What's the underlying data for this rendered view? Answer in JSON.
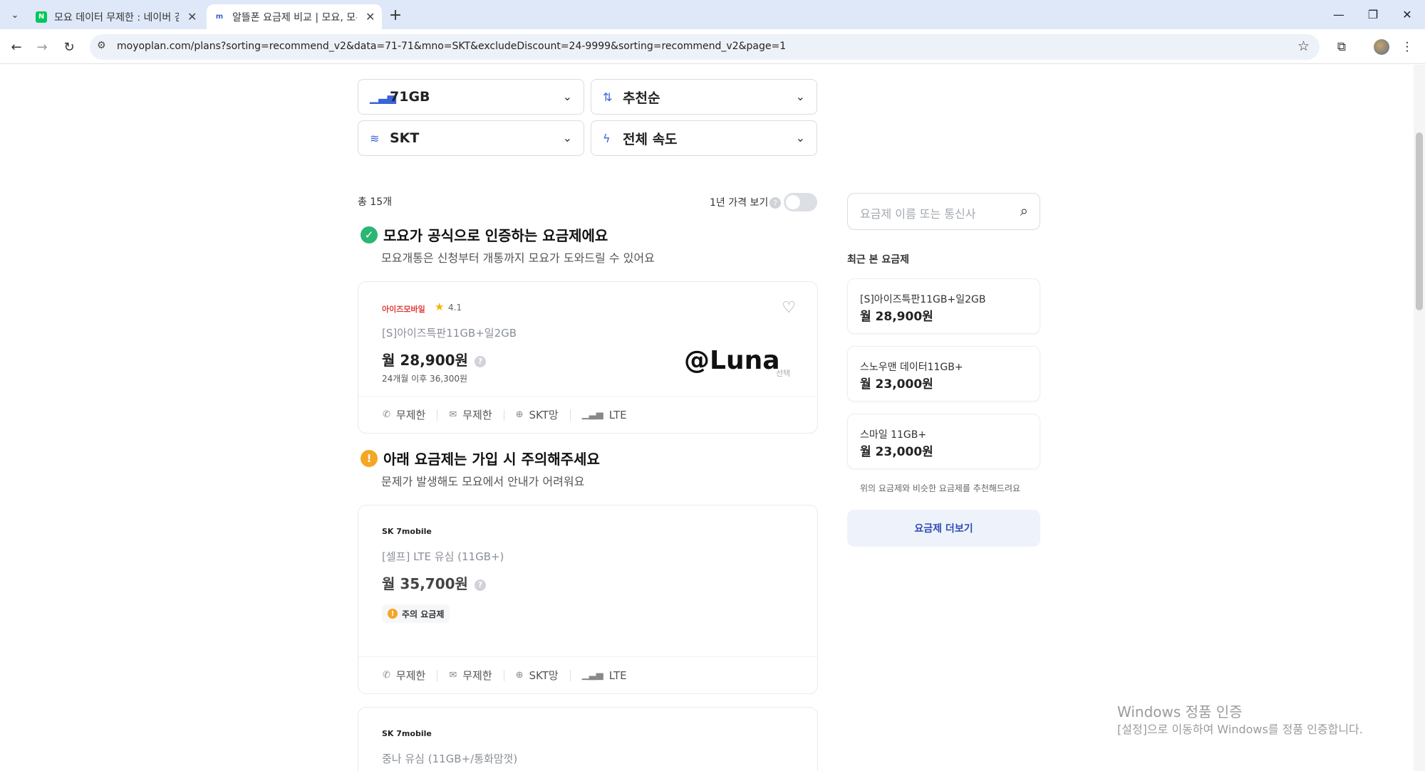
{
  "browser": {
    "tabs": [
      {
        "title": "모요 데이터 무제한 : 네이버 검",
        "favicon": "N"
      },
      {
        "title": "알뜰폰 요금제 비교 | 모요, 모두",
        "favicon": "m"
      }
    ],
    "url": "moyoplan.com/plans?sorting=recommend_v2&data=71-71&mno=SKT&excludeDiscount=24-9999&sorting=recommend_v2&page=1"
  },
  "filters": {
    "data": "71GB",
    "sort": "추천순",
    "network": "SKT",
    "speed": "전체 속도"
  },
  "list": {
    "count": "총 15개",
    "year_price_label": "1년 가격 보기"
  },
  "certified": {
    "title": "모요가 공식으로 인증하는 요금제에요",
    "subtitle": "모요개통은 신청부터 개통까지 모요가 도와드릴 수 있어요"
  },
  "card1": {
    "brand": "아이즈모바일",
    "rating": "4.1",
    "plan": "[S]아이즈특판11GB+일2GB",
    "price": "월 28,900원",
    "after": "24개월 이후 36,300원",
    "selected_note": "선택",
    "features": [
      "무제한",
      "무제한",
      "SKT망",
      "LTE"
    ]
  },
  "caution": {
    "title": "아래 요금제는 가입 시 주의해주세요",
    "subtitle": "문제가 발생해도 모요에서 안내가 어려워요"
  },
  "card2": {
    "brand": "SK 7mobile",
    "plan": "[셀프] LTE 유심 (11GB+)",
    "price": "월 35,700원",
    "chip": "주의 요금제",
    "features": [
      "무제한",
      "무제한",
      "SKT망",
      "LTE"
    ]
  },
  "card3": {
    "brand": "SK 7mobile",
    "plan": "중나 유심 (11GB+/통화맘껏)"
  },
  "sidebar": {
    "search_placeholder": "요금제 이름 또는 통신사",
    "recent_title": "최근 본 요금제",
    "recent": [
      {
        "name": "[S]아이즈특판11GB+일2GB",
        "price": "월 28,900원"
      },
      {
        "name": "스노우맨 데이터11GB+",
        "price": "월 23,000원"
      },
      {
        "name": "스마일 11GB+",
        "price": "월 23,000원"
      }
    ],
    "note": "위의 요금제와 비슷한 요금제를 추천해드려요",
    "more_button": "요금제 더보기"
  },
  "overlay": {
    "luna": "@Luna",
    "windows_title": "Windows 정품 인증",
    "windows_sub": "[설정]으로 이동하여 Windows를 정품 인증합니다."
  }
}
